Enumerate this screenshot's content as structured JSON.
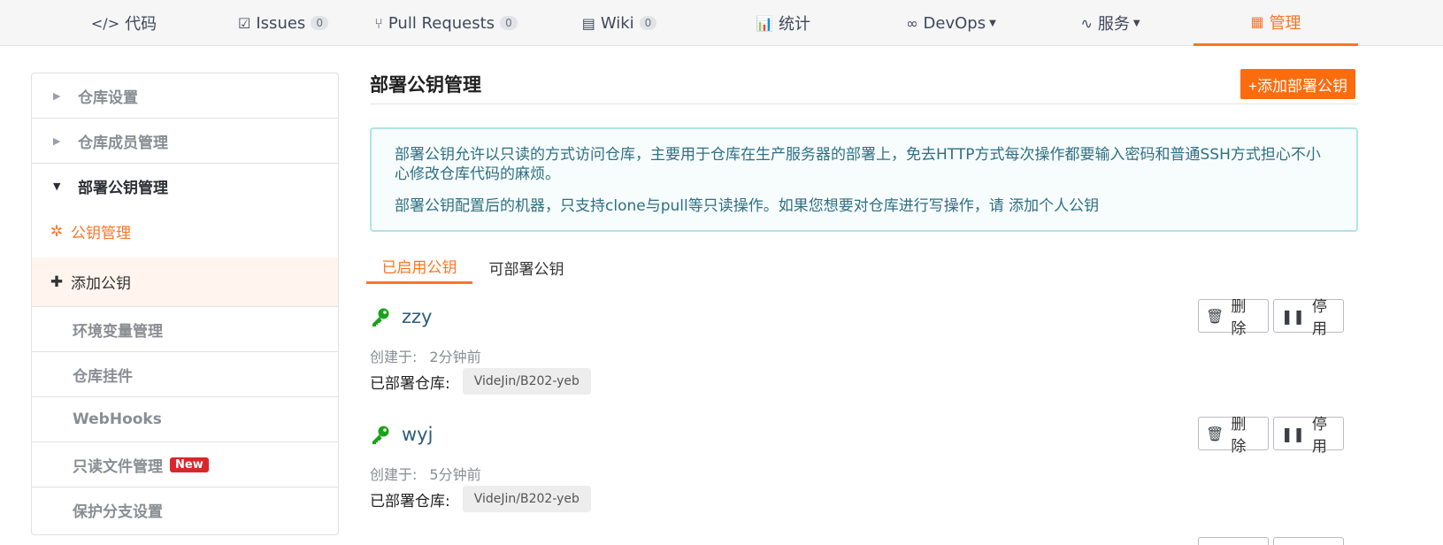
{
  "nav": {
    "tabs": [
      {
        "label": "代码",
        "icon": "code-icon"
      },
      {
        "label": "Issues",
        "count": "0",
        "icon": "issues-icon"
      },
      {
        "label": "Pull Requests",
        "count": "0",
        "icon": "pull-request-icon"
      },
      {
        "label": "Wiki",
        "count": "0",
        "icon": "wiki-icon"
      },
      {
        "label": "统计",
        "icon": "bar-chart-icon"
      },
      {
        "label": "DevOps",
        "icon": "infinity-icon"
      },
      {
        "label": "服务",
        "icon": "pulse-icon"
      },
      {
        "label": "管理",
        "icon": "manage-icon",
        "active": true
      }
    ]
  },
  "sidebar": {
    "items": [
      {
        "label": "仓库设置"
      },
      {
        "label": "仓库成员管理"
      },
      {
        "label": "部署公钥管理"
      },
      {
        "label": "公钥管理"
      },
      {
        "label": "添加公钥"
      },
      {
        "label": "环境变量管理"
      },
      {
        "label": "仓库挂件"
      },
      {
        "label": "WebHooks"
      },
      {
        "label": "只读文件管理",
        "badge": "New"
      },
      {
        "label": "保护分支设置"
      }
    ]
  },
  "main": {
    "title": "部署公钥管理",
    "add_button": "+添加部署公钥",
    "info": {
      "line1": "部署公钥允许以只读的方式访问仓库，主要用于仓库在生产服务器的部署上，免去HTTP方式每次操作都要输入密码和普通SSH方式担心不小心修改仓库代码的麻烦。",
      "line2": "部署公钥配置后的机器，只支持clone与pull等只读操作。如果您想要对仓库进行写操作，请 添加个人公钥"
    },
    "tabs": [
      "已启用公钥",
      "可部署公钥"
    ],
    "keys": [
      {
        "name": "zzy",
        "created_label": "创建于:",
        "created": "2分钟前",
        "deployed_label": "已部署仓库:",
        "repo": "VideJin/B202-yeb",
        "delete": "删除",
        "disable": "停用"
      },
      {
        "name": "wyj",
        "created_label": "创建于:",
        "created": "5分钟前",
        "deployed_label": "已部署仓库:",
        "repo": "VideJin/B202-yeb",
        "delete": "删除",
        "disable": "停用"
      }
    ]
  },
  "colors": {
    "accent": "#fa7628",
    "info_text": "#2f6f82",
    "key_green": "#1aa31a"
  }
}
